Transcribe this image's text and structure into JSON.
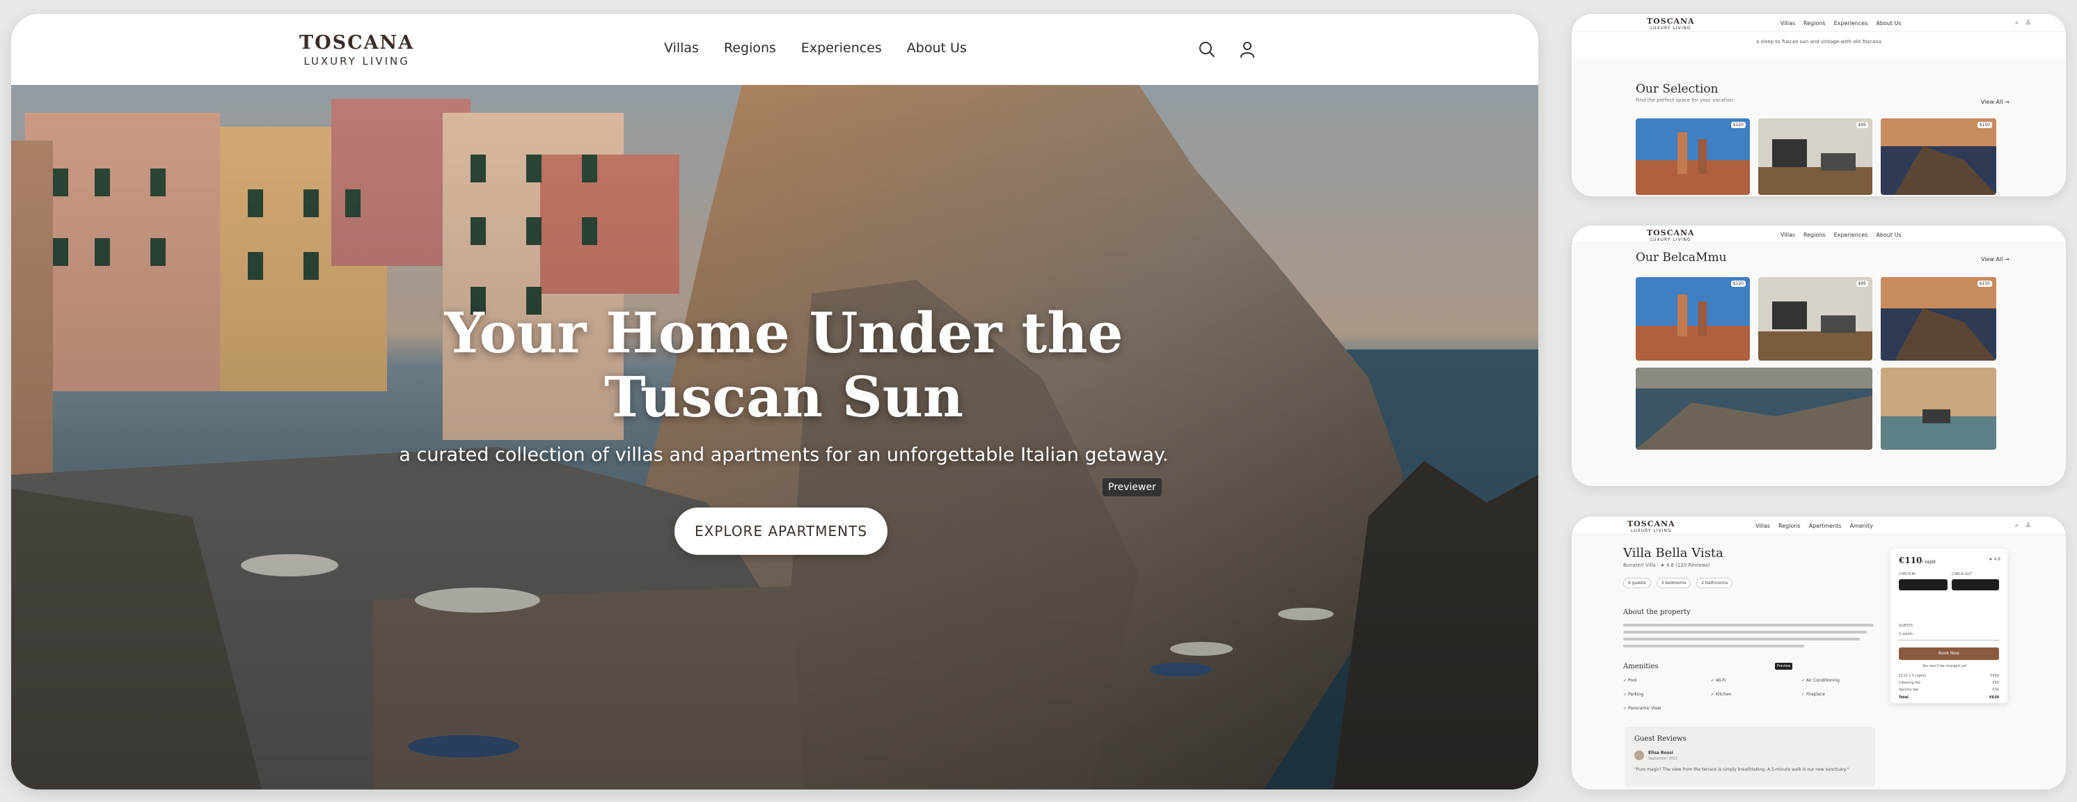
{
  "main": {
    "brand": {
      "name": "TOSCANA",
      "tagline": "LUXURY LIVING"
    },
    "nav": [
      {
        "label": "Villas"
      },
      {
        "label": "Regions"
      },
      {
        "label": "Experiences"
      },
      {
        "label": "About Us"
      }
    ],
    "icons": {
      "search": "search-icon",
      "account": "user-icon"
    },
    "hero": {
      "title_line1": "Your Home Under the",
      "title_line2": "Tuscan Sun",
      "subtitle": "a curated collection of villas and apartments for an unforgettable Italian getaway.",
      "cta": "EXPLORE APARTMENTS",
      "tooltip": "Previewer"
    }
  },
  "preview_nav": {
    "brand": "TOSCANA",
    "tagline": "LUXURY LIVING",
    "items": [
      "Villas",
      "Regions",
      "Experiences",
      "About Us"
    ]
  },
  "card1": {
    "strip_text": "a sleep to Tuscan sun and vintage-with-old Toscana",
    "title": "Our Selection",
    "subtitle": "Find the perfect space for your vacation",
    "view_all": "View All →",
    "badges": [
      "$120",
      "$95",
      "$150"
    ]
  },
  "card2": {
    "title": "Our BelcaMmu",
    "view_all": "View All →",
    "badges": [
      "$120",
      "$95",
      "$150"
    ]
  },
  "card3": {
    "nav_items": [
      "Villas",
      "Regions",
      "Apartments",
      "Amenity"
    ],
    "title": "Villa Bella Vista",
    "meta": "Bonateri Villa · ★ 4.8 (120 Reviews)",
    "chips": [
      "6 guests",
      "3 bedrooms",
      "2 bathrooms"
    ],
    "about_heading": "About the property",
    "amenities_heading": "Amenities",
    "amenities": [
      "Pool",
      "Wi-Fi",
      "Air Conditioning",
      "Parking",
      "Kitchen",
      "Fireplace",
      "Panoramic View"
    ],
    "tooltip": "Preview",
    "reviews_heading": "Guest Reviews",
    "reviewer_name": "Elisa Rossi",
    "reviewer_date": "September 2023",
    "review_text": "\"Pure magic! The view from the terrace is simply breathtaking. A 5-minute walk is our new sanctuary.\"",
    "booking": {
      "price": "€110",
      "price_unit": "/ night",
      "rating": "★ 4.8",
      "check_in": "CHECK-IN",
      "check_out": "CHECK-OUT",
      "guests": "GUESTS",
      "guests_value": "2 adults",
      "button": "Book Now",
      "note": "You won't be charged yet",
      "rows": [
        {
          "label": "€110 x 5 nights",
          "value": "€550"
        },
        {
          "label": "Cleaning fee",
          "value": "€50"
        },
        {
          "label": "Service fee",
          "value": "€30"
        }
      ],
      "total_label": "Total",
      "total_value": "€630"
    }
  }
}
